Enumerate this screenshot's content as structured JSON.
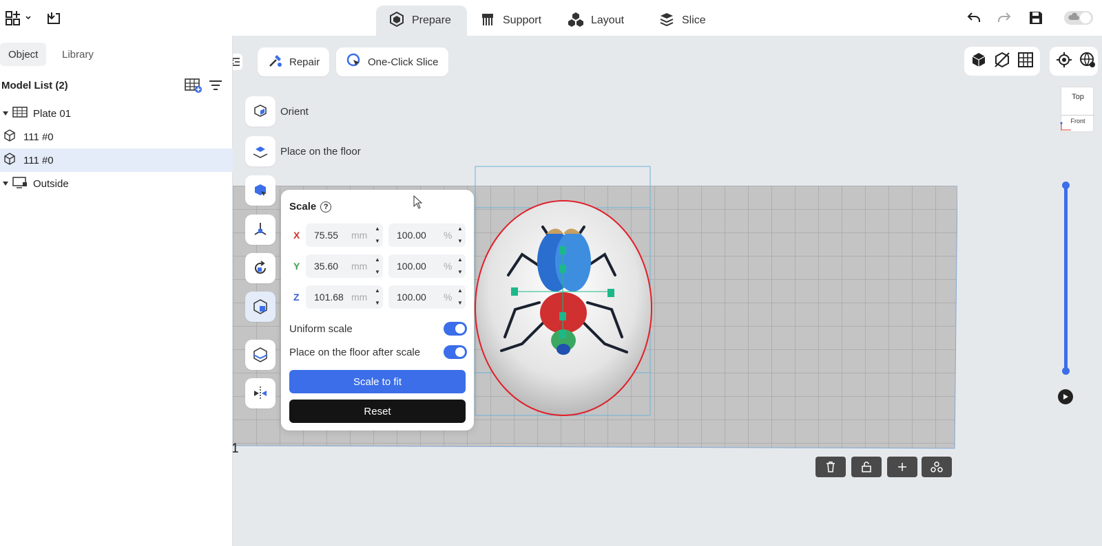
{
  "topbar": {
    "tabs": [
      {
        "label": "Prepare",
        "icon": "prepare-icon"
      },
      {
        "label": "Support",
        "icon": "support-icon"
      },
      {
        "label": "Layout",
        "icon": "layout-icon"
      },
      {
        "label": "Slice",
        "icon": "slice-icon"
      }
    ],
    "active_tab": "Prepare"
  },
  "left_panel": {
    "tabs": [
      "Object",
      "Library"
    ],
    "active_tab": "Object",
    "model_list_title": "Model List (2)",
    "tree": [
      {
        "label": "Plate 01",
        "icon": "plate-icon",
        "expanded": true
      },
      {
        "label": "111 #0",
        "icon": "cube-icon"
      },
      {
        "label": "111 #0",
        "icon": "cube-icon",
        "selected": true
      },
      {
        "label": "Outside",
        "icon": "monitor-icon",
        "expanded": true
      }
    ]
  },
  "toolbar": {
    "repair_label": "Repair",
    "one_click_slice_label": "One-Click Slice"
  },
  "tools": {
    "orient_label": "Orient",
    "place_floor_label": "Place on the floor"
  },
  "scale_panel": {
    "title": "Scale",
    "rows": [
      {
        "axis": "X",
        "mm": "75.55",
        "percent": "100.00",
        "color": "#d0342c"
      },
      {
        "axis": "Y",
        "mm": "35.60",
        "percent": "100.00",
        "color": "#3aa04a"
      },
      {
        "axis": "Z",
        "mm": "101.68",
        "percent": "100.00",
        "color": "#3b5fd0"
      }
    ],
    "unit_mm": "mm",
    "unit_percent": "%",
    "uniform_scale_label": "Uniform scale",
    "uniform_scale_on": true,
    "place_floor_after_label": "Place on the floor after scale",
    "place_floor_after_on": true,
    "scale_to_fit_label": "Scale to fit",
    "reset_label": "Reset"
  },
  "view_cube": {
    "top_label": "Top",
    "front_label": "Front"
  },
  "plate_number": "1",
  "colors": {
    "accent": "#3b6ee8",
    "dark_button": "#141414",
    "selection": "#e4ecf9"
  }
}
